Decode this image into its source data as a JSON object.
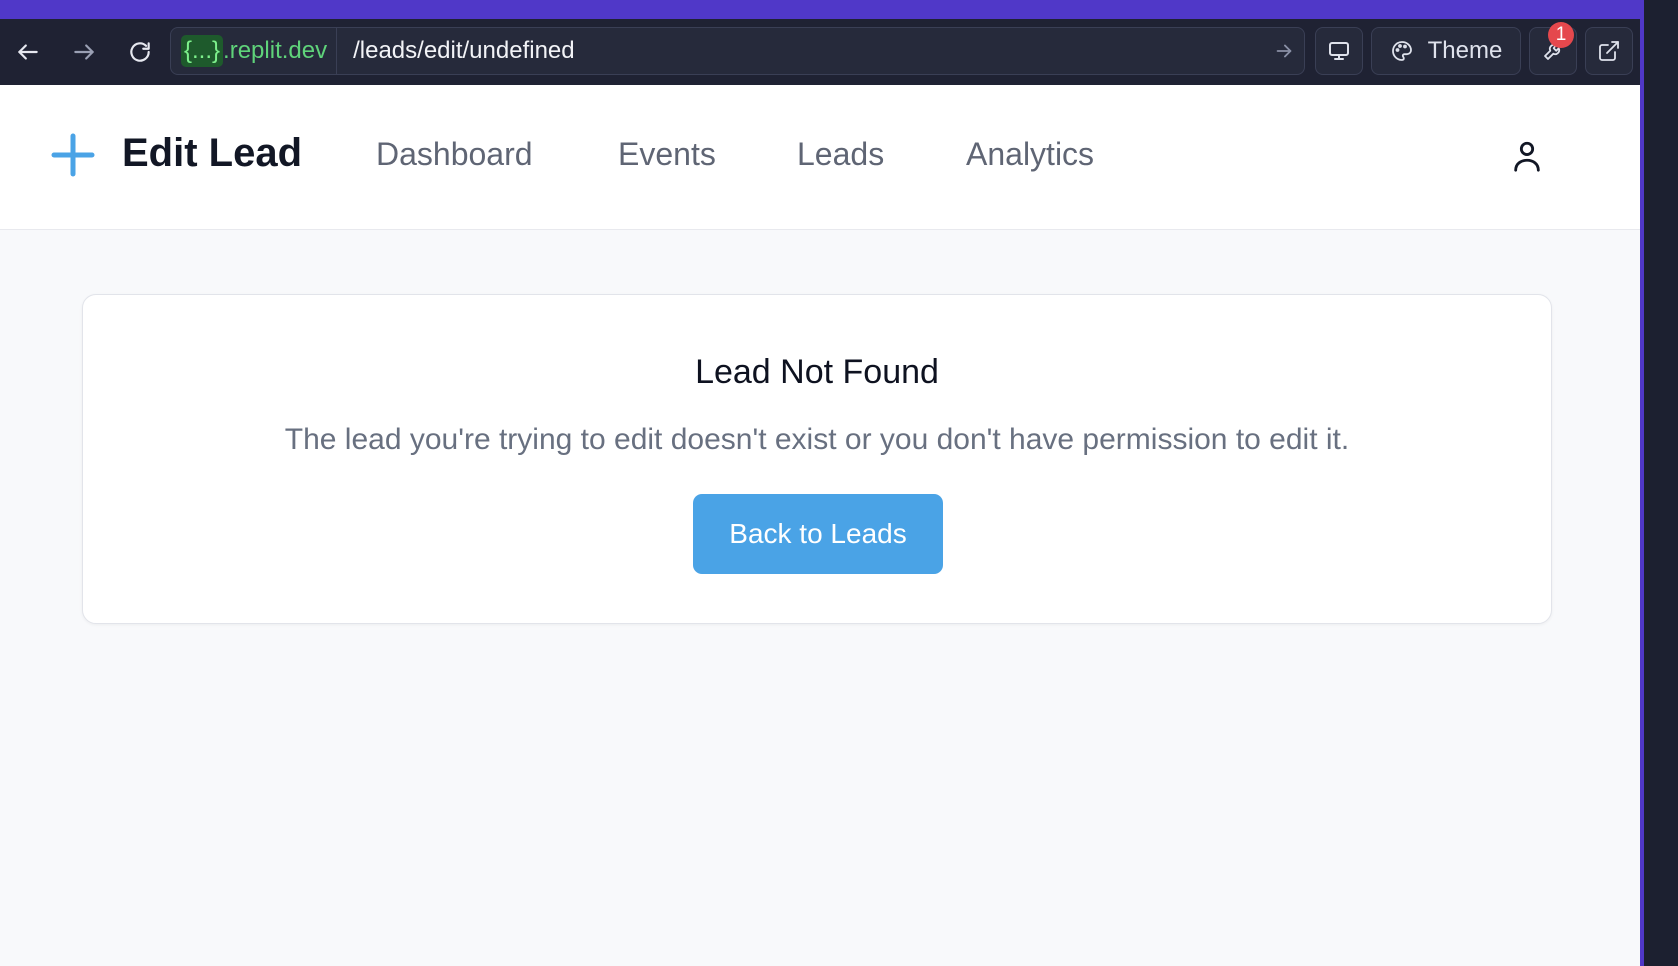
{
  "browser": {
    "url_host_tag": "{...}",
    "url_host": ".replit.dev",
    "url_path": "/leads/edit/undefined",
    "theme_label": "Theme",
    "devtools_badge": "1"
  },
  "header": {
    "title": "Edit Lead",
    "nav": [
      "Dashboard",
      "Events",
      "Leads",
      "Analytics"
    ]
  },
  "main": {
    "title": "Lead Not Found",
    "message": "The lead you're trying to edit doesn't exist or you don't have permission to edit it.",
    "back_button": "Back to Leads"
  },
  "colors": {
    "accent": "#4aa3e6",
    "browser_accent": "#5038c8",
    "host_green": "#5fd37a",
    "badge_red": "#e5484d"
  }
}
